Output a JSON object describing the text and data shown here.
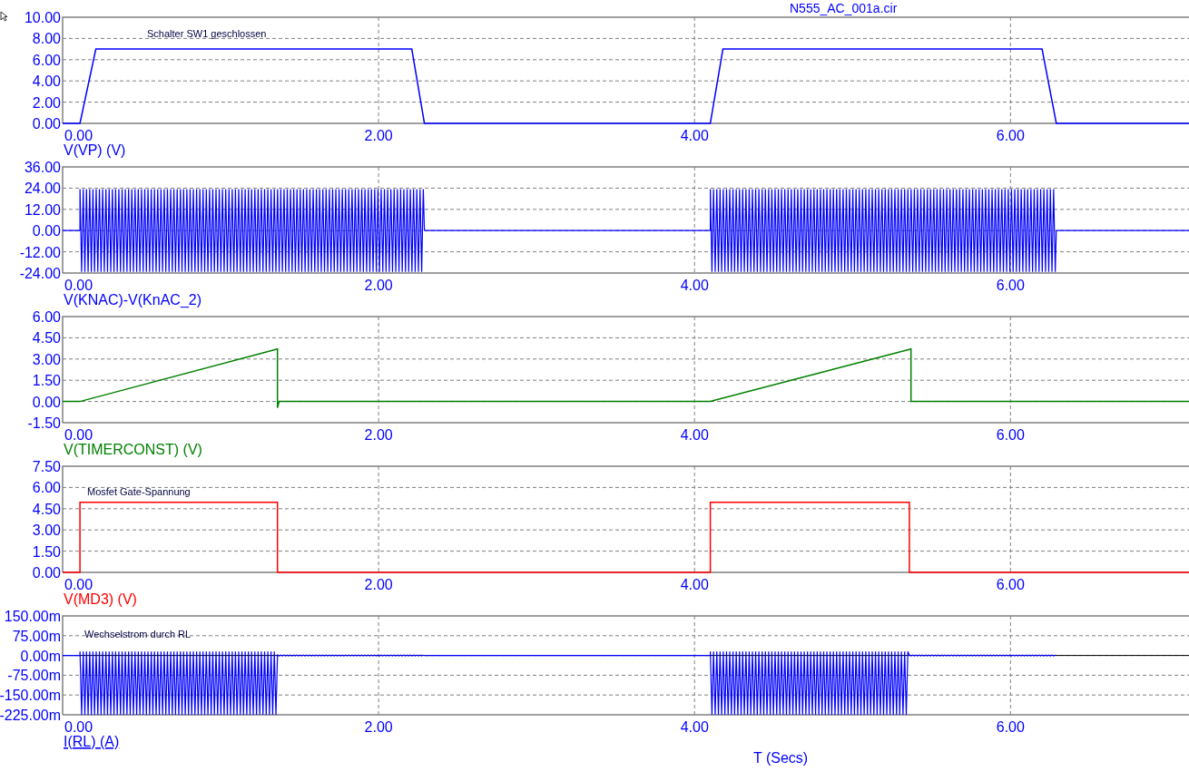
{
  "title": "N555_AC_001a.cir",
  "plots": [
    {
      "label": "V(VP) (V)",
      "color": "#0000ff",
      "chart_data": {
        "type": "line",
        "grid": true,
        "xlim": [
          0,
          7.13
        ],
        "ylim": [
          0,
          10
        ],
        "xticks": [
          {
            "value": 0,
            "label": "0.00"
          },
          {
            "value": 2,
            "label": "2.00"
          },
          {
            "value": 4,
            "label": "4.00"
          },
          {
            "value": 6,
            "label": "6.00"
          }
        ],
        "yticks": [
          {
            "value": 0,
            "label": "0.00"
          },
          {
            "value": 2,
            "label": "2.00"
          },
          {
            "value": 4,
            "label": "4.00"
          },
          {
            "value": 6,
            "label": "6.00"
          },
          {
            "value": 8,
            "label": "8.00"
          },
          {
            "value": 10,
            "label": "10.00"
          }
        ],
        "x": [
          0,
          0.11,
          0.21,
          2.21,
          2.29,
          4.1,
          4.18,
          6.2,
          6.29,
          7.13
        ],
        "series": [
          {
            "color": "#0000ff",
            "values": [
              0,
              0,
              7,
              7,
              0,
              0,
              7,
              7,
              0,
              0
            ]
          }
        ],
        "annotations": [
          "Schalter SW1 geschlossen"
        ]
      }
    },
    {
      "label": "V(KNAC)-V(KnAC_2)",
      "color": "#0000ff",
      "axis": {
        "x_ticks": [
          "0.00",
          "2.00",
          "4.00",
          "6.00"
        ],
        "y_ticks": [
          "36.00",
          "24.00",
          "12.00",
          "0.00",
          "-12.00",
          "-24.00"
        ]
      }
    },
    {
      "label": "V(TIMERCONST) (V)",
      "color": "#008000",
      "chart_data": {
        "type": "line",
        "grid": true,
        "xlim": [
          0,
          7.13
        ],
        "ylim": [
          -1.5,
          6
        ],
        "xticks": [
          {
            "value": 0,
            "label": "0.00"
          },
          {
            "value": 2,
            "label": "2.00"
          },
          {
            "value": 4,
            "label": "4.00"
          },
          {
            "value": 6,
            "label": "6.00"
          }
        ],
        "yticks": [
          {
            "value": -1.5,
            "label": "-1.50"
          },
          {
            "value": 0,
            "label": "0.00"
          },
          {
            "value": 1.5,
            "label": "1.50"
          },
          {
            "value": 3,
            "label": "3.00"
          },
          {
            "value": 4.5,
            "label": "4.50"
          },
          {
            "value": 6,
            "label": "6.00"
          }
        ],
        "x": [
          0,
          0.11,
          1.36,
          1.36,
          1.37,
          4.1,
          5.37,
          5.37,
          5.38,
          7.13
        ],
        "series": [
          {
            "color": "#008000",
            "values": [
              0,
              0,
              3.71,
              -0.45,
              0,
              0,
              3.71,
              0,
              0,
              0
            ]
          }
        ]
      }
    },
    {
      "label": "V(MD3) (V)",
      "color": "#ff0000",
      "chart_data": {
        "type": "line",
        "grid": true,
        "xlim": [
          0,
          7.13
        ],
        "ylim": [
          0,
          7.5
        ],
        "xticks": [
          {
            "value": 0,
            "label": "0.00"
          },
          {
            "value": 2,
            "label": "2.00"
          },
          {
            "value": 4,
            "label": "4.00"
          },
          {
            "value": 6,
            "label": "6.00"
          }
        ],
        "yticks": [
          {
            "value": 0,
            "label": "0.00"
          },
          {
            "value": 1.5,
            "label": "1.50"
          },
          {
            "value": 3,
            "label": "3.00"
          },
          {
            "value": 4.5,
            "label": "4.50"
          },
          {
            "value": 6,
            "label": "6.00"
          },
          {
            "value": 7.5,
            "label": "7.50"
          }
        ],
        "x": [
          0,
          0.11,
          0.11,
          1.36,
          1.36,
          4.1,
          4.1,
          5.36,
          5.36,
          7.13
        ],
        "series": [
          {
            "color": "#ff0000",
            "values": [
              0,
              0,
              4.95,
              4.95,
              0,
              0,
              4.95,
              4.95,
              0,
              0
            ]
          }
        ],
        "annotations": [
          "Mosfet Gate-Spannung"
        ]
      }
    },
    {
      "label": "I(RL) (A)",
      "color": "#0000ff",
      "axis": {
        "x_ticks": [
          "0.00",
          "2.00",
          "4.00",
          "6.00"
        ],
        "y_ticks": [
          "150.00m",
          "75.00m",
          "0.00m",
          "-75.00m",
          "-150.00m",
          "-225.00m"
        ]
      },
      "annotations": [
        "Wechselstrom durch RL"
      ]
    }
  ],
  "x_axis_title": "T (Secs)"
}
